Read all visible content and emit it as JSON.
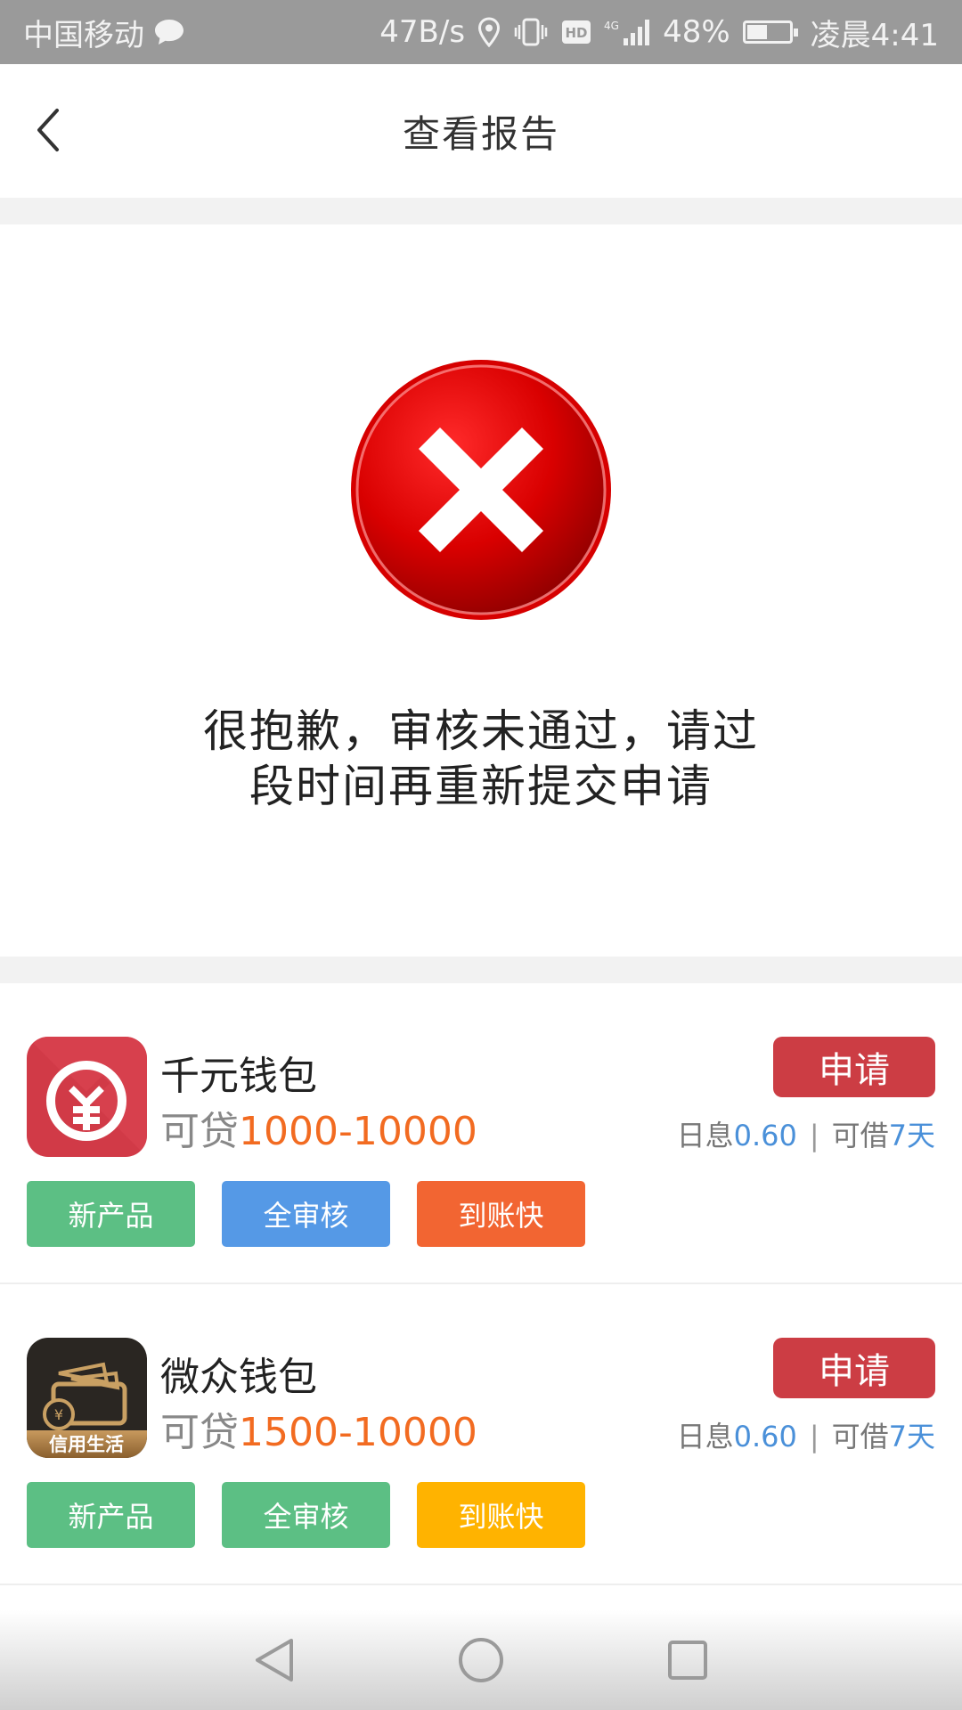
{
  "status_bar": {
    "carrier": "中国移动",
    "net_speed": "47B/s",
    "network": "4G",
    "hd": "HD",
    "battery": "48%",
    "battery_level": 0.48,
    "time": "凌晨4:41"
  },
  "header": {
    "title": "查看报告"
  },
  "result": {
    "icon": "error-x-icon",
    "message_line1": "很抱歉，审核未通过，请过",
    "message_line2": "段时间再重新提交申请"
  },
  "products": [
    {
      "name": "千元钱包",
      "amount_prefix": "可贷",
      "amount": "1000-10000",
      "apply_label": "申请",
      "rate_label": "日息",
      "rate": "0.60",
      "borrow_label": "可借",
      "term": "7天",
      "separator": "|",
      "logo": "qianyuan-wallet-logo",
      "tags": [
        {
          "label": "新产品",
          "color": "#5cbf84"
        },
        {
          "label": "全审核",
          "color": "#5599e6"
        },
        {
          "label": "到账快",
          "color": "#f26532"
        }
      ]
    },
    {
      "name": "微众钱包",
      "amount_prefix": "可贷",
      "amount": "1500-10000",
      "apply_label": "申请",
      "rate_label": "日息",
      "rate": "0.60",
      "borrow_label": "可借",
      "term": "7天",
      "separator": "|",
      "logo": "weizhong-wallet-logo",
      "logo_text": "信用生活",
      "tags": [
        {
          "label": "新产品",
          "color": "#5cbf84"
        },
        {
          "label": "全审核",
          "color": "#5cbf84"
        },
        {
          "label": "到账快",
          "color": "#ffb300"
        }
      ]
    }
  ],
  "colors": {
    "accent_red": "#cc3d44",
    "amount_orange": "#f26b21",
    "rate_blue": "#4a90d9"
  }
}
